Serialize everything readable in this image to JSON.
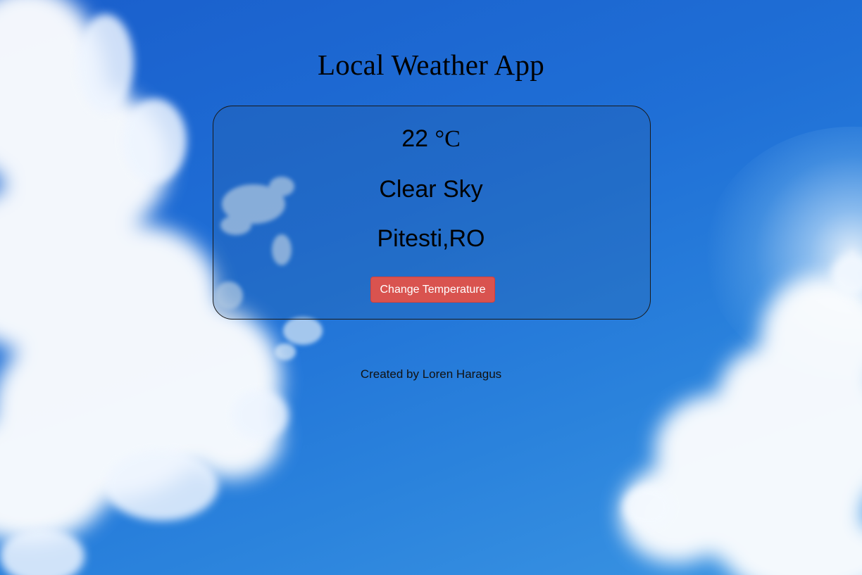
{
  "app": {
    "title": "Local Weather App"
  },
  "weather": {
    "temperature": "22",
    "unit": "°C",
    "condition": "Clear Sky",
    "location": "Pitesti,RO"
  },
  "controls": {
    "change_temperature_label": "Change Temperature"
  },
  "footer": {
    "credit": "Created by Loren Haragus"
  },
  "colors": {
    "button_bg": "#d9534f",
    "button_text": "#ffffff",
    "sky": "#1f6fd6"
  }
}
